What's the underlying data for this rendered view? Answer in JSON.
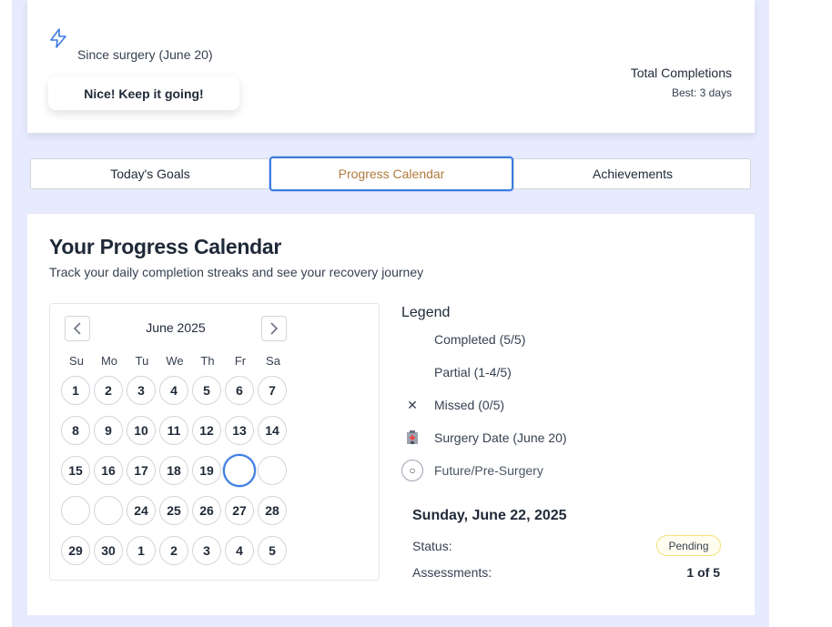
{
  "summary": {
    "since": "Since surgery (June 20)",
    "encouragement": "Nice! Keep it going!",
    "total_label": "Total Completions",
    "best": "Best: 3 days"
  },
  "tabs": [
    {
      "label": "Today's Goals",
      "active": false
    },
    {
      "label": "Progress Calendar",
      "active": true
    },
    {
      "label": "Achievements",
      "active": false
    }
  ],
  "main": {
    "title": "Your Progress Calendar",
    "subtitle": "Track your daily completion streaks and see your recovery journey"
  },
  "calendar": {
    "month": "June 2025",
    "weekdays": [
      "Su",
      "Mo",
      "Tu",
      "We",
      "Th",
      "Fr",
      "Sa"
    ],
    "weeks": [
      [
        "1",
        "2",
        "3",
        "4",
        "5",
        "6",
        "7"
      ],
      [
        "8",
        "9",
        "10",
        "11",
        "12",
        "13",
        "14"
      ],
      [
        "15",
        "16",
        "17",
        "18",
        "19",
        "",
        ""
      ],
      [
        "",
        "",
        "24",
        "25",
        "26",
        "27",
        "28"
      ],
      [
        "29",
        "30",
        "1",
        "2",
        "3",
        "4",
        "5"
      ]
    ]
  },
  "legend": {
    "title": "Legend",
    "items": [
      {
        "icon": "",
        "label": "Completed (5/5)"
      },
      {
        "icon": "✕",
        "label": "Partial (1-4/5)"
      },
      {
        "icon": "✕",
        "label": "Missed (0/5)"
      },
      {
        "icon": "🏥",
        "label": "Surgery Date (June 20)"
      },
      {
        "icon": "○",
        "label": "Future/Pre-Surgery"
      }
    ]
  },
  "detail": {
    "date": "Sunday, June 22, 2025",
    "status_label": "Status:",
    "status_value": "Pending",
    "assessments_label": "Assessments:",
    "assessments_value": "1 of 5"
  },
  "colors": {
    "accent": "#3b7be0",
    "active_tab_text": "#b07b3c",
    "backdrop": "#e6ebfd",
    "pending_border": "#f4e07a"
  }
}
